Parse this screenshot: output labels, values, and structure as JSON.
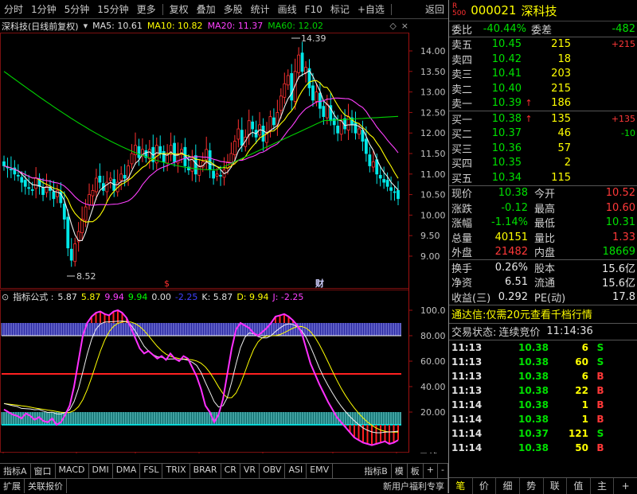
{
  "menu": {
    "items": [
      "分时",
      "1分钟",
      "5分钟",
      "15分钟",
      "更多",
      "复权",
      "叠加",
      "多股",
      "统计",
      "画线",
      "F10",
      "标记",
      "+自选",
      "返回"
    ]
  },
  "chart": {
    "title": "深科技(日线前复权)",
    "ma5": "MA5: 10.61",
    "ma10": "MA10: 10.82",
    "ma20": "MA20: 11.37",
    "ma60": "MA60: 12.02",
    "high_label": "14.39",
    "low_label": "8.52",
    "price_ticks": [
      "14.00",
      "13.50",
      "13.00",
      "12.50",
      "12.00",
      "11.50",
      "11.00",
      "10.50",
      "10.00",
      "9.50",
      "9.00"
    ],
    "markers": [
      "$",
      "财"
    ],
    "indicator_title": "指标公式 :",
    "ind_values": [
      "5.87",
      "5.87",
      "9.94",
      "9.94",
      "0.00",
      "-2.25"
    ],
    "kdj": {
      "k": "K: 5.87",
      "d": "D: 9.94",
      "j": "J: -2.25"
    },
    "ind_ticks": [
      "100.0",
      "80.00",
      "60.00",
      "40.00",
      "20.00"
    ],
    "x_labels": [
      "2022年",
      "5",
      "6",
      "7",
      "8",
      "9",
      "10"
    ],
    "period": "日线"
  },
  "stock": {
    "code": "000021",
    "name": "深科技",
    "badge_r": "R",
    "badge_500": "500"
  },
  "order_book": {
    "weibi_label": "委比",
    "weibi": "-40.44%",
    "weicha_label": "委差",
    "weicha": "-482",
    "asks": [
      {
        "label": "卖五",
        "price": "10.45",
        "vol": "215",
        "chg": "+215",
        "arrow": ""
      },
      {
        "label": "卖四",
        "price": "10.42",
        "vol": "18",
        "chg": "",
        "arrow": ""
      },
      {
        "label": "卖三",
        "price": "10.41",
        "vol": "203",
        "chg": "",
        "arrow": ""
      },
      {
        "label": "卖二",
        "price": "10.40",
        "vol": "215",
        "chg": "",
        "arrow": ""
      },
      {
        "label": "卖一",
        "price": "10.39",
        "vol": "186",
        "chg": "",
        "arrow": "↑"
      }
    ],
    "bids": [
      {
        "label": "买一",
        "price": "10.38",
        "vol": "135",
        "chg": "+135",
        "arrow": "↑"
      },
      {
        "label": "买二",
        "price": "10.37",
        "vol": "46",
        "chg": "-10",
        "arrow": ""
      },
      {
        "label": "买三",
        "price": "10.36",
        "vol": "57",
        "chg": "",
        "arrow": ""
      },
      {
        "label": "买四",
        "price": "10.35",
        "vol": "2",
        "chg": "",
        "arrow": ""
      },
      {
        "label": "买五",
        "price": "10.34",
        "vol": "115",
        "chg": "",
        "arrow": ""
      }
    ]
  },
  "quote": [
    {
      "l1": "现价",
      "v1": "10.38",
      "l2": "今开",
      "v2": "10.52"
    },
    {
      "l1": "涨跌",
      "v1": "-0.12",
      "l2": "最高",
      "v2": "10.60"
    },
    {
      "l1": "涨幅",
      "v1": "-1.14%",
      "l2": "最低",
      "v2": "10.31"
    },
    {
      "l1": "总量",
      "v1": "40151",
      "l2": "量比",
      "v2": "1.33"
    },
    {
      "l1": "外盘",
      "v1": "21482",
      "l2": "内盘",
      "v2": "18669"
    }
  ],
  "fundamentals": [
    {
      "l1": "换手",
      "v1": "0.26%",
      "l2": "股本",
      "v2": "15.6亿"
    },
    {
      "l1": "净资",
      "v1": "6.51",
      "l2": "流通",
      "v2": "15.6亿"
    },
    {
      "l1": "收益(三)",
      "v1": "0.292",
      "l2": "PE(动)",
      "v2": "17.8"
    }
  ],
  "promo": "通达信:仅需20元查看千档行情",
  "status": {
    "label": "交易状态:",
    "value": "连续竞价",
    "time": "11:14:36"
  },
  "ticks": [
    {
      "time": "11:13",
      "price": "10.38",
      "vol": "6",
      "side": "S"
    },
    {
      "time": "11:13",
      "price": "10.38",
      "vol": "60",
      "side": "S"
    },
    {
      "time": "11:13",
      "price": "10.38",
      "vol": "6",
      "side": "B"
    },
    {
      "time": "11:13",
      "price": "10.38",
      "vol": "22",
      "side": "B"
    },
    {
      "time": "11:14",
      "price": "10.38",
      "vol": "1",
      "side": "B"
    },
    {
      "time": "11:14",
      "price": "10.38",
      "vol": "1",
      "side": "B"
    },
    {
      "time": "11:14",
      "price": "10.37",
      "vol": "121",
      "side": "S"
    },
    {
      "time": "11:14",
      "price": "10.38",
      "vol": "50",
      "side": "B"
    }
  ],
  "bottom_tabs1": [
    "指标A",
    "窗口",
    "MACD",
    "DMI",
    "DMA",
    "FSL",
    "TRIX",
    "BRAR",
    "CR",
    "VR",
    "OBV",
    "ASI",
    "EMV"
  ],
  "bottom_tabs1_right": [
    "指标B",
    "模",
    "板",
    "+",
    "-"
  ],
  "bottom_tabs2": [
    "扩展",
    "关联报价"
  ],
  "bottom_right_promo": "新用户福利专享",
  "right_tabs": [
    "笔",
    "价",
    "细",
    "势",
    "联",
    "值",
    "主",
    "+"
  ]
}
